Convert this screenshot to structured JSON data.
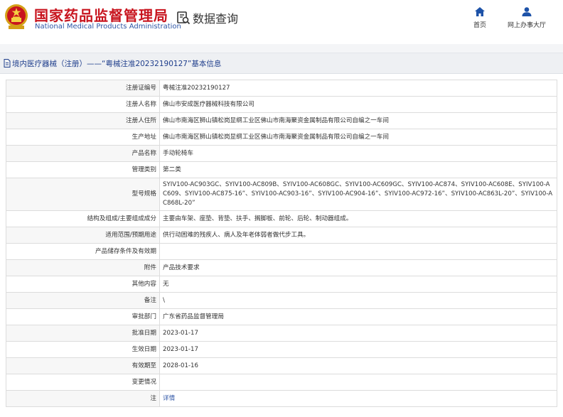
{
  "header": {
    "brand_cn": "国家药品监督管理局",
    "brand_en": "National Medical Products Administration",
    "query_label": "数据查询",
    "nav": [
      {
        "icon": "home-icon",
        "label": "首页"
      },
      {
        "icon": "user-icon",
        "label": "网上办事大厅"
      }
    ]
  },
  "page_title": "境内医疗器械（注册）——“粤械注准20232190127”基本信息",
  "colors": {
    "brand_red": "#c8141e",
    "brand_blue": "#2f56a6",
    "title_blue": "#1f3e8c",
    "icon_blue": "#1d52a8"
  },
  "rows": [
    {
      "key": "注册证编号",
      "value": "粤械注准20232190127"
    },
    {
      "key": "注册人名称",
      "value": "佛山市安成医疗器械科技有限公司"
    },
    {
      "key": "注册人住所",
      "value": "佛山市南海区狮山镇松岗显纲工业区佛山市南海聚资金属制品有限公司自编之一车间"
    },
    {
      "key": "生产地址",
      "value": "佛山市南海区狮山镇松岗显纲工业区佛山市南海聚资金属制品有限公司自编之一车间"
    },
    {
      "key": "产品名称",
      "value": "手动轮椅车"
    },
    {
      "key": "管理类别",
      "value": "第二类"
    },
    {
      "key": "型号规格",
      "value": "SYIV100-AC903GC、SYIV100-AC809B、SYIV100-AC608GC、SYIV100-AC609GC、SYIV100-AC874、SYIV100-AC608E、SYIV100-AC609、SYIV100-AC875-16”、SYIV100-AC903-16”、SYIV100-AC904-16”、SYIV100-AC972-16”、SYIV100-AC863L-20”、SYIV100-AC868L-20”"
    },
    {
      "key": "结构及组成/主要组成成分",
      "value": "主要由车架、座垫、背垫、扶手、搁脚板、前轮、后轮、制动器组成。"
    },
    {
      "key": "适用范围/预期用途",
      "value": "供行动困难的残疾人、病人及年老体弱者做代步工具。"
    },
    {
      "key": "产品储存条件及有效期",
      "value": ""
    },
    {
      "key": "附件",
      "value": "产品技术要求"
    },
    {
      "key": "其他内容",
      "value": "无"
    },
    {
      "key": "备注",
      "value": "\\"
    },
    {
      "key": "审批部门",
      "value": "广东省药品监督管理局"
    },
    {
      "key": "批准日期",
      "value": "2023-01-17"
    },
    {
      "key": "生效日期",
      "value": "2023-01-17"
    },
    {
      "key": "有效期至",
      "value": "2028-01-16"
    },
    {
      "key": "变更情况",
      "value": ""
    },
    {
      "key": "注",
      "value": "详情",
      "link": true
    }
  ]
}
